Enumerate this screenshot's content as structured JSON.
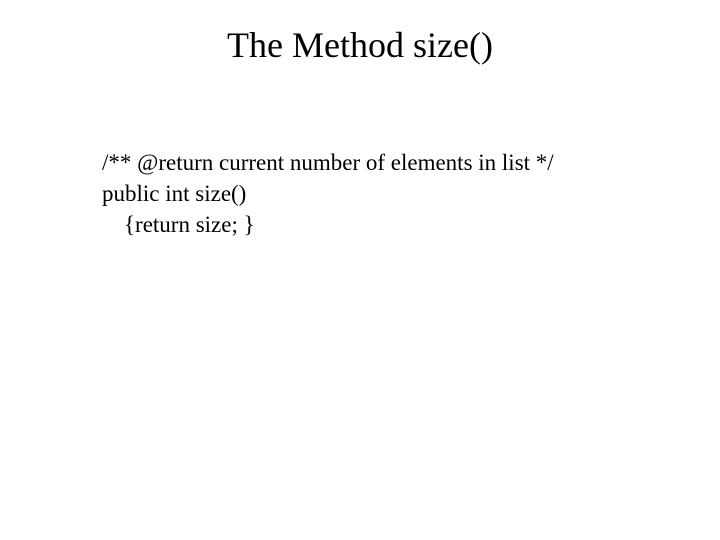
{
  "title": "The Method size()",
  "code": {
    "line1": "/** @return current number of elements in list */",
    "line2": "public int size()",
    "line3": "{return size; }"
  }
}
